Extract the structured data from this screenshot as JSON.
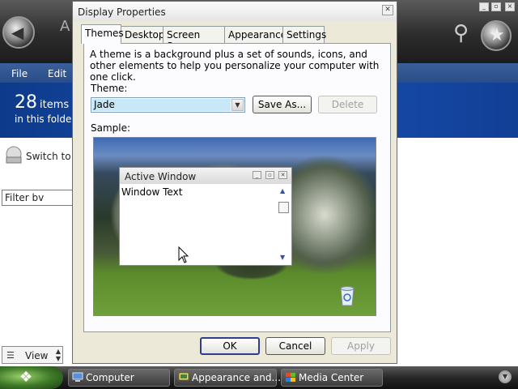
{
  "background": {
    "title": "A",
    "menu": [
      "File",
      "Edit"
    ],
    "count": "28",
    "count_unit": "items",
    "count_sub": "in this folder",
    "switch_label": "Switch to C",
    "filter_label": "Filter bv",
    "view_label": "View"
  },
  "dialog": {
    "title": "Display Properties",
    "tabs": [
      "Themes",
      "Desktop",
      "Screen Saver",
      "Appearance",
      "Settings"
    ],
    "description": "A theme is a background plus a set of sounds, icons, and other elements to help you personalize your computer with one click.",
    "theme_label": "Theme:",
    "theme_value": "Jade",
    "save_as_label": "Save As...",
    "delete_label": "Delete",
    "sample_label": "Sample:",
    "ok_label": "OK",
    "cancel_label": "Cancel",
    "apply_label": "Apply"
  },
  "preview": {
    "window_title": "Active Window",
    "window_text": "Window Text"
  },
  "taskbar": {
    "items": [
      "Computer",
      "Appearance and...",
      "Media Center"
    ]
  },
  "colors": {
    "dialog_face": "#ece9d8",
    "selection": "#c8e8f8",
    "banner": "#164fb0",
    "taskbar": "#262626"
  }
}
